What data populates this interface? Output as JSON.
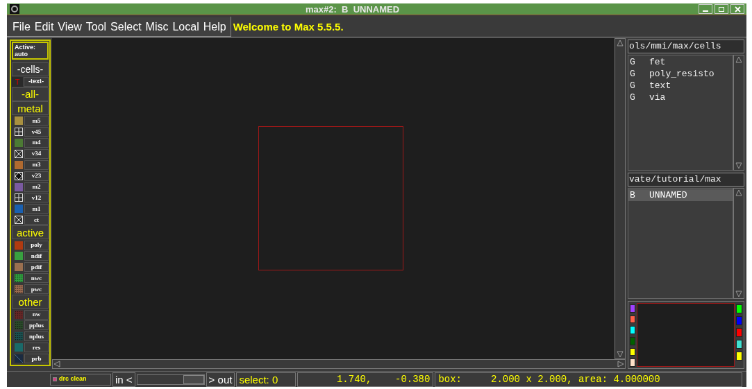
{
  "window": {
    "title": "max#2:  B  UNNAMED"
  },
  "menu": [
    "File",
    "Edit",
    "View",
    "Tool",
    "Select",
    "Misc",
    "Local",
    "Help"
  ],
  "message": "Welcome to Max 5.5.5.",
  "sidebar": [
    {
      "kind": "status",
      "label": "Active:",
      "value": "auto"
    },
    {
      "kind": "button",
      "label": "-cells-"
    },
    {
      "kind": "text-layer",
      "icon": "T",
      "label": "-text-"
    },
    {
      "kind": "group",
      "label": "-all-"
    },
    {
      "kind": "group",
      "label": "metal"
    },
    {
      "kind": "solid",
      "label": "m5",
      "color": "#a89040"
    },
    {
      "kind": "grid",
      "label": "v45",
      "color": "#303030"
    },
    {
      "kind": "solid",
      "label": "m4",
      "color": "#4c7a34"
    },
    {
      "kind": "cross",
      "label": "v34",
      "color": "#303030"
    },
    {
      "kind": "solid",
      "label": "m3",
      "color": "#b06a30"
    },
    {
      "kind": "diamond",
      "label": "v23",
      "color": "#303030"
    },
    {
      "kind": "solid",
      "label": "m2",
      "color": "#7a5aa0"
    },
    {
      "kind": "grid",
      "label": "v12",
      "color": "#303030"
    },
    {
      "kind": "solid",
      "label": "m1",
      "color": "#1a60b0"
    },
    {
      "kind": "cross",
      "label": "ct",
      "color": "#303030"
    },
    {
      "kind": "group",
      "label": "active"
    },
    {
      "kind": "solid",
      "label": "poly",
      "color": "#b03a10"
    },
    {
      "kind": "solid",
      "label": "ndif",
      "color": "#38a040"
    },
    {
      "kind": "solid",
      "label": "pdif",
      "color": "#9a7050"
    },
    {
      "kind": "dots",
      "label": "nwc",
      "color": "#30a040"
    },
    {
      "kind": "dots",
      "label": "pwc",
      "color": "#9a6a50"
    },
    {
      "kind": "group",
      "label": "other"
    },
    {
      "kind": "dots",
      "label": "nw",
      "color": "#6a2828"
    },
    {
      "kind": "dots",
      "label": "pplus",
      "color": "#2a4a2a"
    },
    {
      "kind": "dots",
      "label": "nplus",
      "color": "#1a5050"
    },
    {
      "kind": "solid",
      "label": "res",
      "color": "#1a6a6a"
    },
    {
      "kind": "stripe",
      "label": "prb",
      "color": "#1a2a40"
    }
  ],
  "cell_library": {
    "path": "ols/mmi/max/cells",
    "items": [
      {
        "type": "G",
        "name": "fet",
        "selected": false
      },
      {
        "type": "G",
        "name": "poly_resisto",
        "selected": false
      },
      {
        "type": "G",
        "name": "text",
        "selected": false
      },
      {
        "type": "G",
        "name": "via",
        "selected": false
      }
    ]
  },
  "cell_list": {
    "path": "vate/tutorial/max",
    "items": [
      {
        "type": "B",
        "name": "UNNAMED",
        "selected": true
      }
    ]
  },
  "palette": {
    "left": [
      {
        "color": "#a040ff"
      },
      {
        "color": "#ff6048"
      },
      {
        "color": "#00ffff"
      },
      {
        "color": "#006000"
      },
      {
        "color": "#ffff00"
      },
      {
        "color": "#ffe0c8"
      }
    ],
    "right": [
      {
        "color": "#00ff00"
      },
      {
        "color": "#0000ff"
      },
      {
        "color": "#ff0000"
      },
      {
        "color": "#40e0d0"
      },
      {
        "color": "#ffff00"
      }
    ]
  },
  "zoom": {
    "level": 1
  },
  "status_bar": {
    "drc": "drc clean",
    "zoom_in": "in <",
    "zoom_out": "> out",
    "select": "select: 0",
    "coords": "1.740,    -0.380",
    "box": "box:     2.000 x 2.000, area: 4.000000"
  }
}
